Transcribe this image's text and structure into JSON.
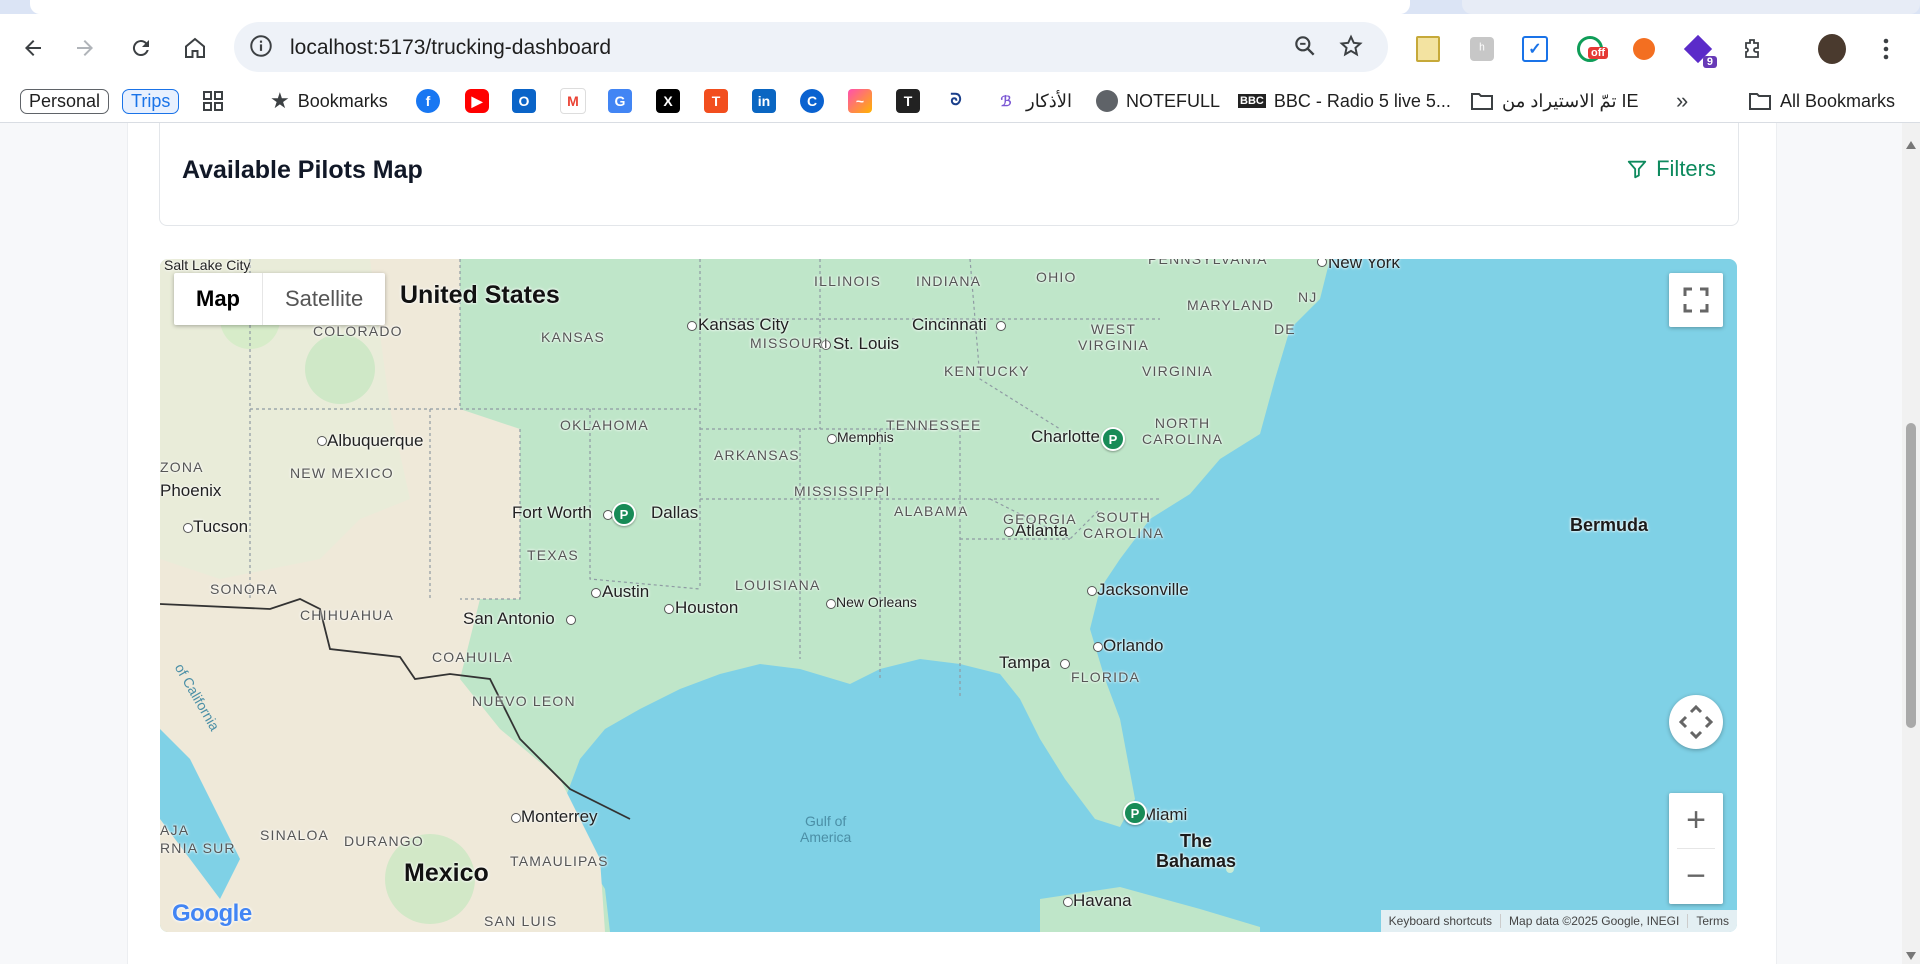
{
  "browser": {
    "url": "localhost:5173/trucking-dashboard",
    "bookmarks_bar": {
      "profile_chips": [
        "Personal",
        "Trips"
      ],
      "bookmarks_label": "Bookmarks",
      "arabic_bookmark": "الأذكار",
      "notefull": "NOTEFULL",
      "bbc": "BBC - Radio 5 live 5...",
      "folder_import": "تمّ الاستيراد من IE",
      "all_bookmarks": "All Bookmarks"
    },
    "extension_badges": {
      "off_badge": "off",
      "count_badge": "9"
    }
  },
  "page": {
    "card_title": "Available Pilots Map",
    "filters_label": "Filters"
  },
  "map": {
    "type_buttons": {
      "map": "Map",
      "satellite": "Satellite"
    },
    "zoom": {
      "in": "+",
      "out": "−"
    },
    "attribution": {
      "keyboard": "Keyboard shortcuts",
      "data": "Map data ©2025 Google, INEGI",
      "terms": "Terms"
    },
    "google_logo": "Google",
    "labels": {
      "salt_lake_city": "Salt Lake City",
      "united_states": "United States",
      "kansas_city": "Kansas City",
      "st_louis": "St. Louis",
      "cincinnati": "Cincinnati",
      "illinois": "ILLINOIS",
      "indiana": "INDIANA",
      "ohio": "OHIO",
      "pennsylvania": "PENNSYLVANIA",
      "new_york": "New York",
      "nj": "NJ",
      "maryland": "MARYLAND",
      "de": "DE",
      "colorado": "COLORADO",
      "kansas": "KANSAS",
      "missouri": "MISSOURI",
      "west_virginia": "WEST\nVIRGINIA",
      "kentucky": "KENTUCKY",
      "virginia": "VIRGINIA",
      "oklahoma": "OKLAHOMA",
      "tennessee": "TENNESSEE",
      "memphis": "Memphis",
      "charlotte": "Charlotte",
      "north_carolina": "NORTH\nCAROLINA",
      "albuquerque": "Albuquerque",
      "arkansas": "ARKANSAS",
      "arizona": "ZONA",
      "new_mexico": "NEW MEXICO",
      "mississippi": "MISSISSIPPI",
      "atlanta": "Atlanta",
      "south_carolina": "SOUTH\nCAROLINA",
      "phoenix": "Phoenix",
      "alabama": "ALABAMA",
      "georgia": "GEORGIA",
      "fort_worth": "Fort Worth",
      "dallas": "Dallas",
      "tucson": "Tucson",
      "texas": "TEXAS",
      "bermuda": "Bermuda",
      "louisiana": "LOUISIANA",
      "austin": "Austin",
      "jacksonville": "Jacksonville",
      "sonora": "SONORA",
      "houston": "Houston",
      "new_orleans": "New Orleans",
      "chihuahua": "CHIHUAHUA",
      "san_antonio": "San Antonio",
      "orlando": "Orlando",
      "coahuila": "COAHUILA",
      "tampa": "Tampa",
      "florida": "FLORIDA",
      "gulf_of_california": "of California",
      "nuevo_leon": "NUEVO LEON",
      "monterrey": "Monterrey",
      "miami": "Miami",
      "gulf_of_america": "Gulf of\nAmerica",
      "baja": "AJA\nRNIA SUR",
      "sinaloa": "SINALOA",
      "durango": "DURANGO",
      "the_bahamas": "The\nBahamas",
      "mexico": "Mexico",
      "tamaulipas": "TAMAULIPAS",
      "havana": "Havana",
      "san_luis": "SAN LUIS"
    },
    "pilot_marker_label": "P",
    "colors": {
      "water": "#7fd1e6",
      "land_green": "#bfe6c9",
      "land_tan": "#efe9d9",
      "pin": "#188b57"
    }
  }
}
